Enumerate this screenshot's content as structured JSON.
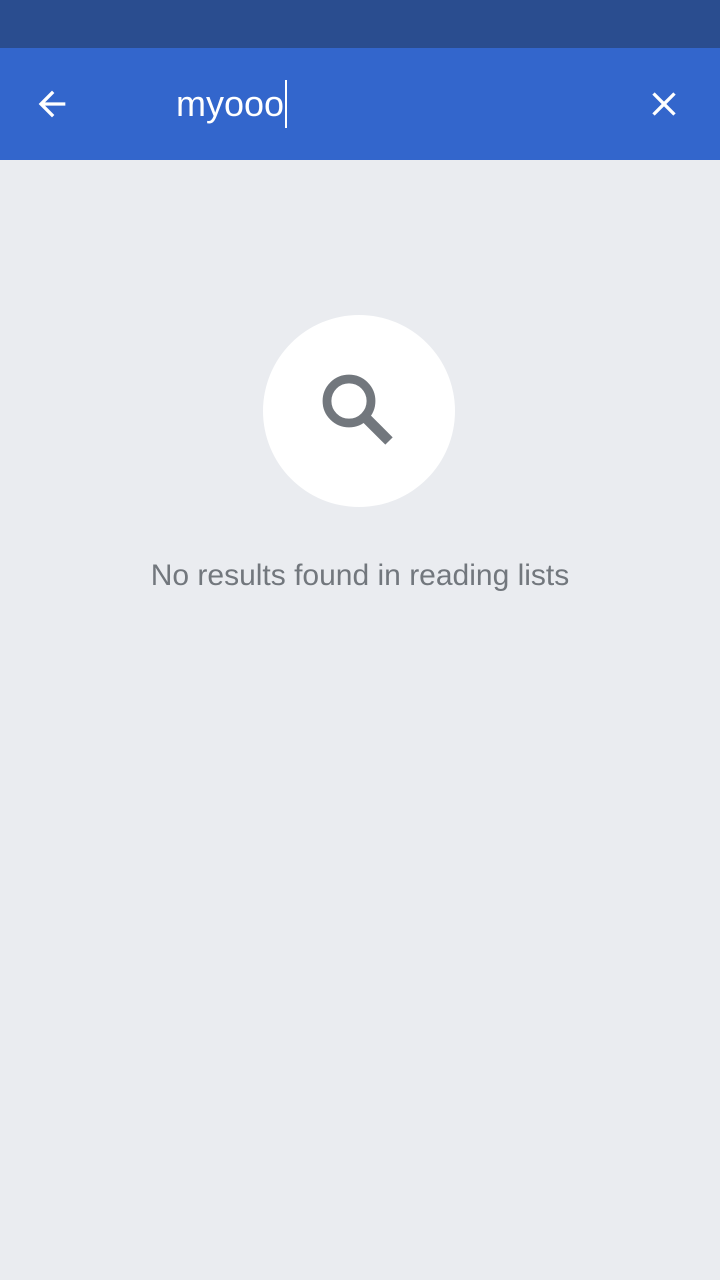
{
  "search": {
    "query": "myooo"
  },
  "empty_state": {
    "message": "No results found in reading lists"
  },
  "icons": {
    "back": "arrow-back-icon",
    "clear": "close-icon",
    "empty": "search-icon"
  },
  "colors": {
    "status_bar": "#2a4d8f",
    "toolbar": "#3366cc",
    "background": "#eaecf0",
    "icon_gray": "#72777d"
  }
}
